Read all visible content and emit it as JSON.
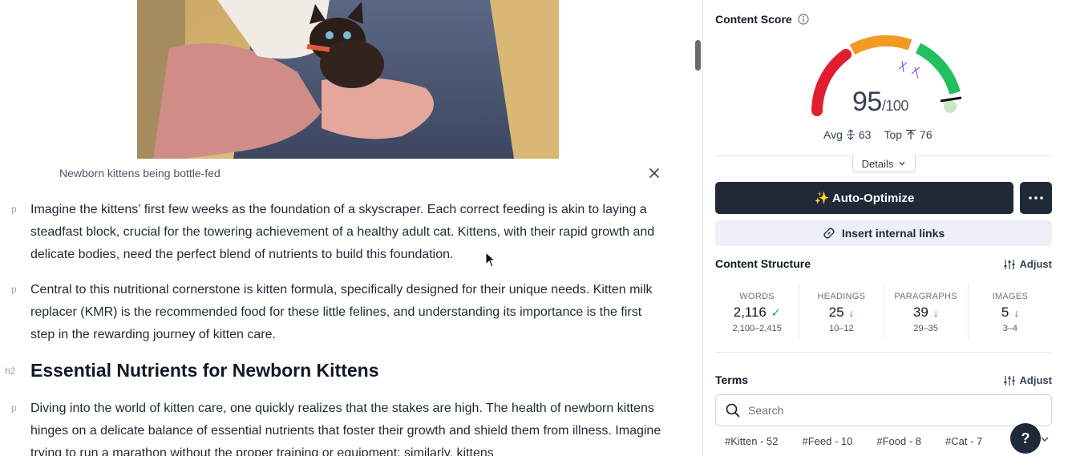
{
  "editor": {
    "caption": "Newborn kittens being bottle-fed",
    "blocks": [
      {
        "tag": "p",
        "text": "Imagine the kittens’ first few weeks as the foundation of a skyscraper. Each correct feeding is akin to laying a steadfast block, crucial for the towering achievement of a healthy adult cat. Kittens, with their rapid growth and delicate bodies, need the perfect blend of nutrients to build this foundation."
      },
      {
        "tag": "p",
        "text": "Central to this nutritional cornerstone is kitten formula, specifically designed for their unique needs. Kitten milk replacer (KMR) is the recommended food for these little felines, and understanding its importance is the first step in the rewarding journey of kitten care."
      },
      {
        "tag": "h2",
        "text": "Essential Nutrients for Newborn Kittens"
      },
      {
        "tag": "p",
        "text": "Diving into the world of kitten care, one quickly realizes that the stakes are high. The health of newborn kittens hinges on a delicate balance of essential nutrients that foster their growth and shield them from illness. Imagine trying to run a marathon without the proper training or equipment; similarly, kittens"
      }
    ]
  },
  "sidebar": {
    "content_score": {
      "title": "Content Score",
      "score": "95",
      "max": "/100",
      "avg_label": "Avg",
      "avg_value": "63",
      "top_label": "Top",
      "top_value": "76",
      "details_label": "Details"
    },
    "auto_optimize_label": "✨ Auto-Optimize",
    "insert_links_label": "Insert internal links",
    "structure": {
      "title": "Content Structure",
      "adjust_label": "Adjust",
      "metrics": [
        {
          "label": "WORDS",
          "value": "2,116",
          "status": "✓",
          "range": "2,100–2,415"
        },
        {
          "label": "HEADINGS",
          "value": "25",
          "status": "↓",
          "range": "10–12"
        },
        {
          "label": "PARAGRAPHS",
          "value": "39",
          "status": "↓",
          "range": "29–35"
        },
        {
          "label": "IMAGES",
          "value": "5",
          "status": "↓",
          "range": "3–4"
        }
      ]
    },
    "terms": {
      "title": "Terms",
      "adjust_label": "Adjust",
      "search_placeholder": "Search",
      "chips": [
        "#Kitten - 52",
        "#Feed - 10",
        "#Food - 8",
        "#Cat - 7"
      ]
    },
    "help_label": "?"
  },
  "colors": {
    "dark_button": "#1f2937",
    "gauge_red": "#e11d2e",
    "gauge_orange": "#f29a21",
    "gauge_green": "#21c05c",
    "links_bg": "#eef0f7"
  }
}
